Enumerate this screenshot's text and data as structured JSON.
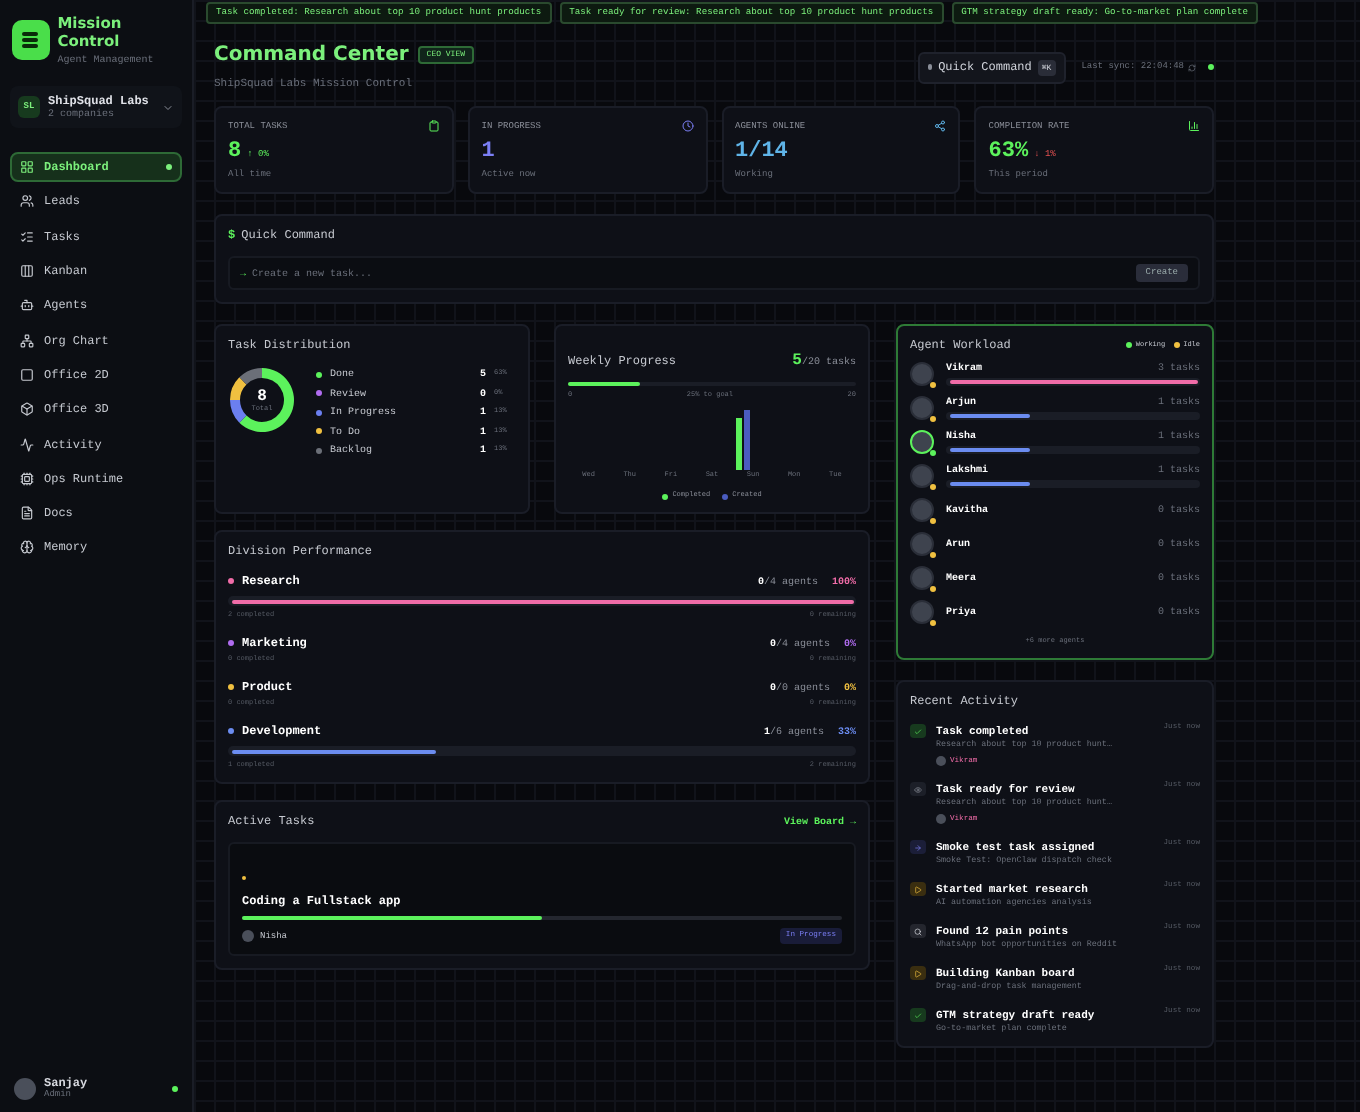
{
  "ticker": [
    "Task completed: Research about top 10 product hunt products",
    "Task ready for review: Research about top 10 product hunt products",
    "GTM strategy draft ready: Go-to-market plan complete"
  ],
  "sidebar": {
    "app_title": "Mission Control",
    "app_subtitle": "Agent Management",
    "company": {
      "initials": "SL",
      "name": "ShipSquad Labs",
      "count": "2 companies"
    },
    "items": [
      {
        "label": "Dashboard",
        "selected": true
      },
      {
        "label": "Leads",
        "selected": false
      },
      {
        "label": "Tasks",
        "selected": false
      },
      {
        "label": "Kanban",
        "selected": false
      },
      {
        "label": "Agents",
        "selected": false
      },
      {
        "label": "Org Chart",
        "selected": false
      },
      {
        "label": "Office 2D",
        "selected": false
      },
      {
        "label": "Office 3D",
        "selected": false
      },
      {
        "label": "Activity",
        "selected": false
      },
      {
        "label": "Ops Runtime",
        "selected": false
      },
      {
        "label": "Docs",
        "selected": false
      },
      {
        "label": "Memory",
        "selected": false
      }
    ],
    "user": {
      "name": "Sanjay",
      "role": "Admin"
    }
  },
  "header": {
    "title": "Command Center",
    "badge": "CEO VIEW",
    "subtitle": "ShipSquad Labs Mission Control",
    "quick_command": "Quick Command",
    "shortcut": "⌘K",
    "last_sync": "Last sync: 22:04:48"
  },
  "stats": [
    {
      "label": "TOTAL TASKS",
      "value": "8",
      "trend": {
        "text": "↑ 0%",
        "rising": true
      },
      "note": "All time",
      "color": "#5cf25c"
    },
    {
      "label": "IN PROGRESS",
      "value": "1",
      "note": "Active now",
      "color": "#7b7ff5"
    },
    {
      "label": "AGENTS ONLINE",
      "value": "1/14",
      "note": "Working",
      "color": "#5fb4e8"
    },
    {
      "label": "COMPLETION RATE",
      "value": "63%",
      "trend": {
        "text": "↓ 1%",
        "rising": false
      },
      "note": "This period",
      "color": "#5cf25c"
    }
  ],
  "quick_command": {
    "title": "Quick Command",
    "prompt": "$",
    "arrow": "→",
    "placeholder": "Create a new task...",
    "button": "Create"
  },
  "task_distribution": {
    "title": "Task Distribution",
    "total": "8",
    "total_label": "Total",
    "legend": [
      {
        "count": "5",
        "pct": "63%",
        "color": "#5cf25c"
      },
      {
        "count": "0",
        "pct": "0%",
        "color": "#b06cf0"
      },
      {
        "count": "1",
        "pct": "13%",
        "color": "#6b7ff0"
      },
      {
        "count": "1",
        "pct": "13%",
        "color": "#f0c040"
      },
      {
        "count": "1",
        "pct": "13%",
        "color": "#6b6f78"
      }
    ],
    "chart_data": {
      "type": "donut",
      "categories": [
        "Done",
        "Review",
        "In Progress",
        "To Do",
        "Backlog"
      ],
      "values": [
        62.5,
        0,
        12.5,
        12.5,
        12.5
      ]
    }
  },
  "weekly_progress": {
    "title": "Weekly Progress",
    "done": "5",
    "goal": "/20 tasks",
    "level": 0.25,
    "start": "0",
    "goal_note": "25% to goal",
    "end": "20",
    "days": [
      "Wed",
      "Thu",
      "Fri",
      "Sat",
      "Sun",
      "Mon",
      "Tue"
    ],
    "legend": [
      {
        "label": "Completed",
        "color": "#5cf25c"
      },
      {
        "label": "Created",
        "color": "#4a5cc0"
      }
    ]
  },
  "divisions": {
    "title": "Division Performance",
    "items": [
      {
        "name": "Research",
        "agents": "0",
        "agents_total": "/4 agents",
        "pct": "100%",
        "level": 1,
        "completed": "2 completed",
        "remaining": "0 remaining",
        "color": "#f06ca8"
      },
      {
        "name": "Marketing",
        "agents": "0",
        "agents_total": "/4 agents",
        "pct": "0%",
        "completed": "0 completed",
        "remaining": "0 remaining",
        "color": "#b06cf0"
      },
      {
        "name": "Product",
        "agents": "0",
        "agents_total": "/0 agents",
        "pct": "0%",
        "completed": "0 completed",
        "remaining": "0 remaining",
        "color": "#f0c040"
      },
      {
        "name": "Development",
        "agents": "1",
        "agents_total": "/6 agents",
        "pct": "33%",
        "level": 0.33,
        "completed": "1 completed",
        "remaining": "2 remaining",
        "color": "#6b8cf0"
      }
    ]
  },
  "active_tasks": {
    "title": "Active Tasks",
    "link": "View Board →",
    "items": [
      {
        "title": "Coding a Fullstack app",
        "level": 0.5,
        "assignee": "Nisha",
        "status": "In Progress"
      }
    ]
  },
  "agent_workload": {
    "title": "Agent Workload",
    "legend": [
      {
        "label": "Working",
        "color": "#5cf25c"
      },
      {
        "label": "Idle",
        "color": "#f0c040"
      }
    ],
    "agents": [
      {
        "name": "Vikram",
        "tasks": "3 tasks",
        "level": 1,
        "working": false,
        "color": "#f06ca8"
      },
      {
        "name": "Arjun",
        "tasks": "1 tasks",
        "level": 0.33,
        "working": false,
        "color": "#6b8cf0"
      },
      {
        "name": "Nisha",
        "tasks": "1 tasks",
        "level": 0.33,
        "working": true,
        "color": "#6b8cf0"
      },
      {
        "name": "Lakshmi",
        "tasks": "1 tasks",
        "level": 0.33,
        "working": false,
        "color": "#6b8cf0"
      },
      {
        "name": "Kavitha",
        "tasks": "0 tasks",
        "working": false
      },
      {
        "name": "Arun",
        "tasks": "0 tasks",
        "working": false
      },
      {
        "name": "Meera",
        "tasks": "0 tasks",
        "working": false
      },
      {
        "name": "Priya",
        "tasks": "0 tasks",
        "working": false
      }
    ],
    "more": "+6 more agents"
  },
  "recent_activity": {
    "title": "Recent Activity",
    "items": [
      {
        "kind": "check",
        "title": "Task completed",
        "detail": "Research about top 10 product hunt…",
        "actor": "Vikram",
        "time": "Just now"
      },
      {
        "kind": "review",
        "title": "Task ready for review",
        "detail": "Research about top 10 product hunt…",
        "actor": "Vikram",
        "time": "Just now"
      },
      {
        "kind": "assign",
        "title": "Smoke test task assigned",
        "detail": "Smoke Test: OpenClaw dispatch check",
        "time": "Just now"
      },
      {
        "kind": "start",
        "title": "Started market research",
        "detail": "AI automation agencies analysis",
        "time": "Just now"
      },
      {
        "kind": "search",
        "title": "Found 12 pain points",
        "detail": "WhatsApp bot opportunities on Reddit",
        "time": "Just now"
      },
      {
        "kind": "start",
        "title": "Building Kanban board",
        "detail": "Drag-and-drop task management",
        "time": "Just now"
      },
      {
        "kind": "check",
        "title": "GTM strategy draft ready",
        "detail": "Go-to-market plan complete",
        "time": "Just now"
      }
    ]
  }
}
